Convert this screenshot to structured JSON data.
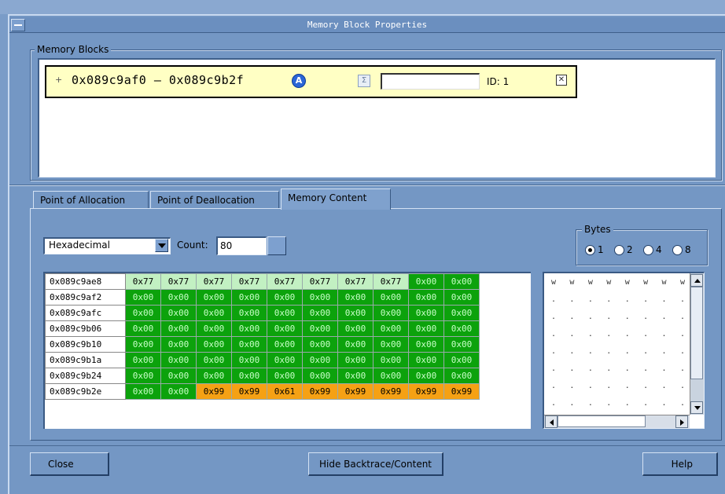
{
  "window": {
    "title": "Memory Block Properties"
  },
  "memory_blocks": {
    "legend": "Memory Blocks",
    "block": {
      "range_text": "0x089c9af0  –  0x089c9b2f",
      "annotation_value": "",
      "id_label": "ID: 1"
    }
  },
  "tabs": [
    {
      "label": "Point of Allocation",
      "active": false
    },
    {
      "label": "Point of Deallocation",
      "active": false
    },
    {
      "label": "Memory Content",
      "active": true
    }
  ],
  "content": {
    "format_value": "Hexadecimal",
    "count_label": "Count:",
    "count_value": "80",
    "bytes_legend": "Bytes",
    "bytes_options": [
      "1",
      "2",
      "4",
      "8"
    ],
    "bytes_selected": "1"
  },
  "memory_rows": [
    {
      "addr": "0x089c9ae8",
      "bytes": [
        "0x77",
        "0x77",
        "0x77",
        "0x77",
        "0x77",
        "0x77",
        "0x77",
        "0x77",
        "0x00",
        "0x00"
      ],
      "colors": [
        "light",
        "light",
        "light",
        "light",
        "light",
        "light",
        "light",
        "light",
        "green",
        "green"
      ]
    },
    {
      "addr": "0x089c9af2",
      "bytes": [
        "0x00",
        "0x00",
        "0x00",
        "0x00",
        "0x00",
        "0x00",
        "0x00",
        "0x00",
        "0x00",
        "0x00"
      ],
      "colors": [
        "green",
        "green",
        "green",
        "green",
        "green",
        "green",
        "green",
        "green",
        "green",
        "green"
      ]
    },
    {
      "addr": "0x089c9afc",
      "bytes": [
        "0x00",
        "0x00",
        "0x00",
        "0x00",
        "0x00",
        "0x00",
        "0x00",
        "0x00",
        "0x00",
        "0x00"
      ],
      "colors": [
        "green",
        "green",
        "green",
        "green",
        "green",
        "green",
        "green",
        "green",
        "green",
        "green"
      ]
    },
    {
      "addr": "0x089c9b06",
      "bytes": [
        "0x00",
        "0x00",
        "0x00",
        "0x00",
        "0x00",
        "0x00",
        "0x00",
        "0x00",
        "0x00",
        "0x00"
      ],
      "colors": [
        "green",
        "green",
        "green",
        "green",
        "green",
        "green",
        "green",
        "green",
        "green",
        "green"
      ]
    },
    {
      "addr": "0x089c9b10",
      "bytes": [
        "0x00",
        "0x00",
        "0x00",
        "0x00",
        "0x00",
        "0x00",
        "0x00",
        "0x00",
        "0x00",
        "0x00"
      ],
      "colors": [
        "green",
        "green",
        "green",
        "green",
        "green",
        "green",
        "green",
        "green",
        "green",
        "green"
      ]
    },
    {
      "addr": "0x089c9b1a",
      "bytes": [
        "0x00",
        "0x00",
        "0x00",
        "0x00",
        "0x00",
        "0x00",
        "0x00",
        "0x00",
        "0x00",
        "0x00"
      ],
      "colors": [
        "green",
        "green",
        "green",
        "green",
        "green",
        "green",
        "green",
        "green",
        "green",
        "green"
      ]
    },
    {
      "addr": "0x089c9b24",
      "bytes": [
        "0x00",
        "0x00",
        "0x00",
        "0x00",
        "0x00",
        "0x00",
        "0x00",
        "0x00",
        "0x00",
        "0x00"
      ],
      "colors": [
        "green",
        "green",
        "green",
        "green",
        "green",
        "green",
        "green",
        "green",
        "green",
        "green"
      ]
    },
    {
      "addr": "0x089c9b2e",
      "bytes": [
        "0x00",
        "0x00",
        "0x99",
        "0x99",
        "0x61",
        "0x99",
        "0x99",
        "0x99",
        "0x99",
        "0x99"
      ],
      "colors": [
        "green",
        "green",
        "orange",
        "orange",
        "orange",
        "orange",
        "orange",
        "orange",
        "orange",
        "orange"
      ]
    }
  ],
  "ascii_rows": [
    [
      "w",
      "w",
      "w",
      "w",
      "w",
      "w",
      "w",
      "w"
    ],
    [
      ".",
      ".",
      ".",
      ".",
      ".",
      ".",
      ".",
      "."
    ],
    [
      ".",
      ".",
      ".",
      ".",
      ".",
      ".",
      ".",
      "."
    ],
    [
      ".",
      ".",
      ".",
      ".",
      ".",
      ".",
      ".",
      "."
    ],
    [
      ".",
      ".",
      ".",
      ".",
      ".",
      ".",
      ".",
      "."
    ],
    [
      ".",
      ".",
      ".",
      ".",
      ".",
      ".",
      ".",
      "."
    ],
    [
      ".",
      ".",
      ".",
      ".",
      ".",
      ".",
      ".",
      "."
    ],
    [
      ".",
      ".",
      ".",
      ".",
      ".",
      ".",
      ".",
      "."
    ]
  ],
  "buttons": {
    "close": "Close",
    "hide": "Hide Backtrace/Content",
    "help": "Help"
  },
  "colors": {
    "window_bg": "#7497c4",
    "block_highlight": "#ffffc4",
    "cell_light": "#c2f0c2",
    "cell_green": "#0ca20c",
    "cell_orange": "#f5a114"
  },
  "icons": [
    "window-menu-icon",
    "address-info-icon",
    "sigma-icon",
    "close-block-icon"
  ]
}
